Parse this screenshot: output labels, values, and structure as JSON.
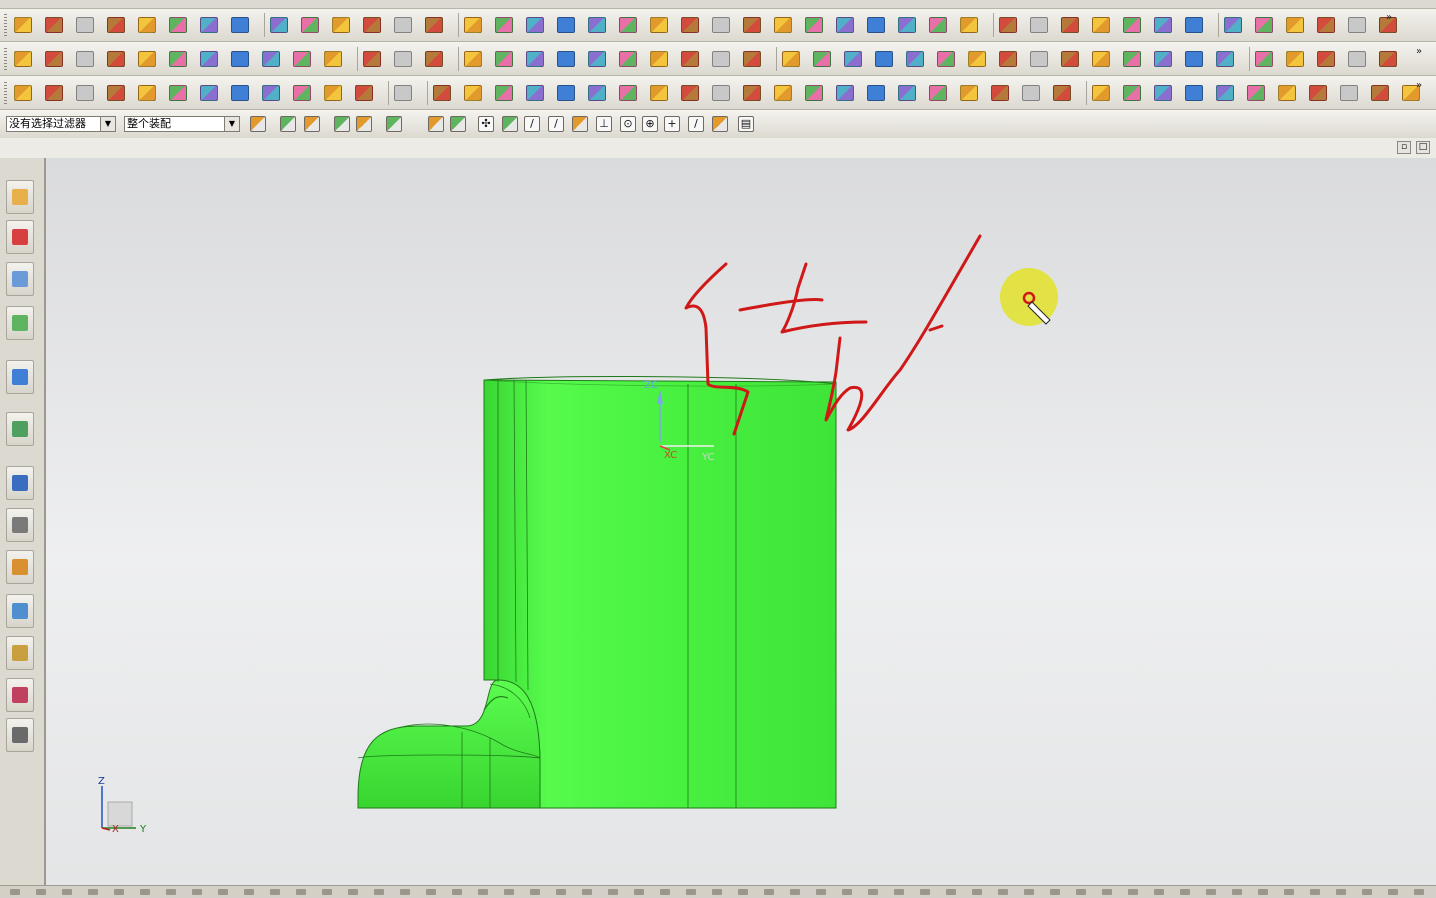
{
  "selection_bar": {
    "type_filter": "没有选择过滤器",
    "scope": "整个装配"
  },
  "viewport": {
    "wcs_labels": {
      "zc": "ZC",
      "yc": "YC",
      "xc": "XC"
    },
    "triad_labels": {
      "z": "Z",
      "x": "X",
      "y": "Y"
    },
    "model_color": "#44ef3c",
    "annotation_color": "#d01818",
    "cursor_highlight_color": "#e2e21e"
  },
  "icons": {
    "resource_bar": [
      "assembly-navigator-icon",
      "constraint-navigator-icon",
      "part-navigator-icon",
      "reuse-library-icon",
      "hd3d-tools-icon",
      "web-browser-icon",
      "history-icon",
      "process-studio-icon",
      "manufacturing-wizards-icon",
      "roles-icon",
      "system-materials-icon",
      "system-scenes-icon",
      "palettes-icon"
    ]
  }
}
